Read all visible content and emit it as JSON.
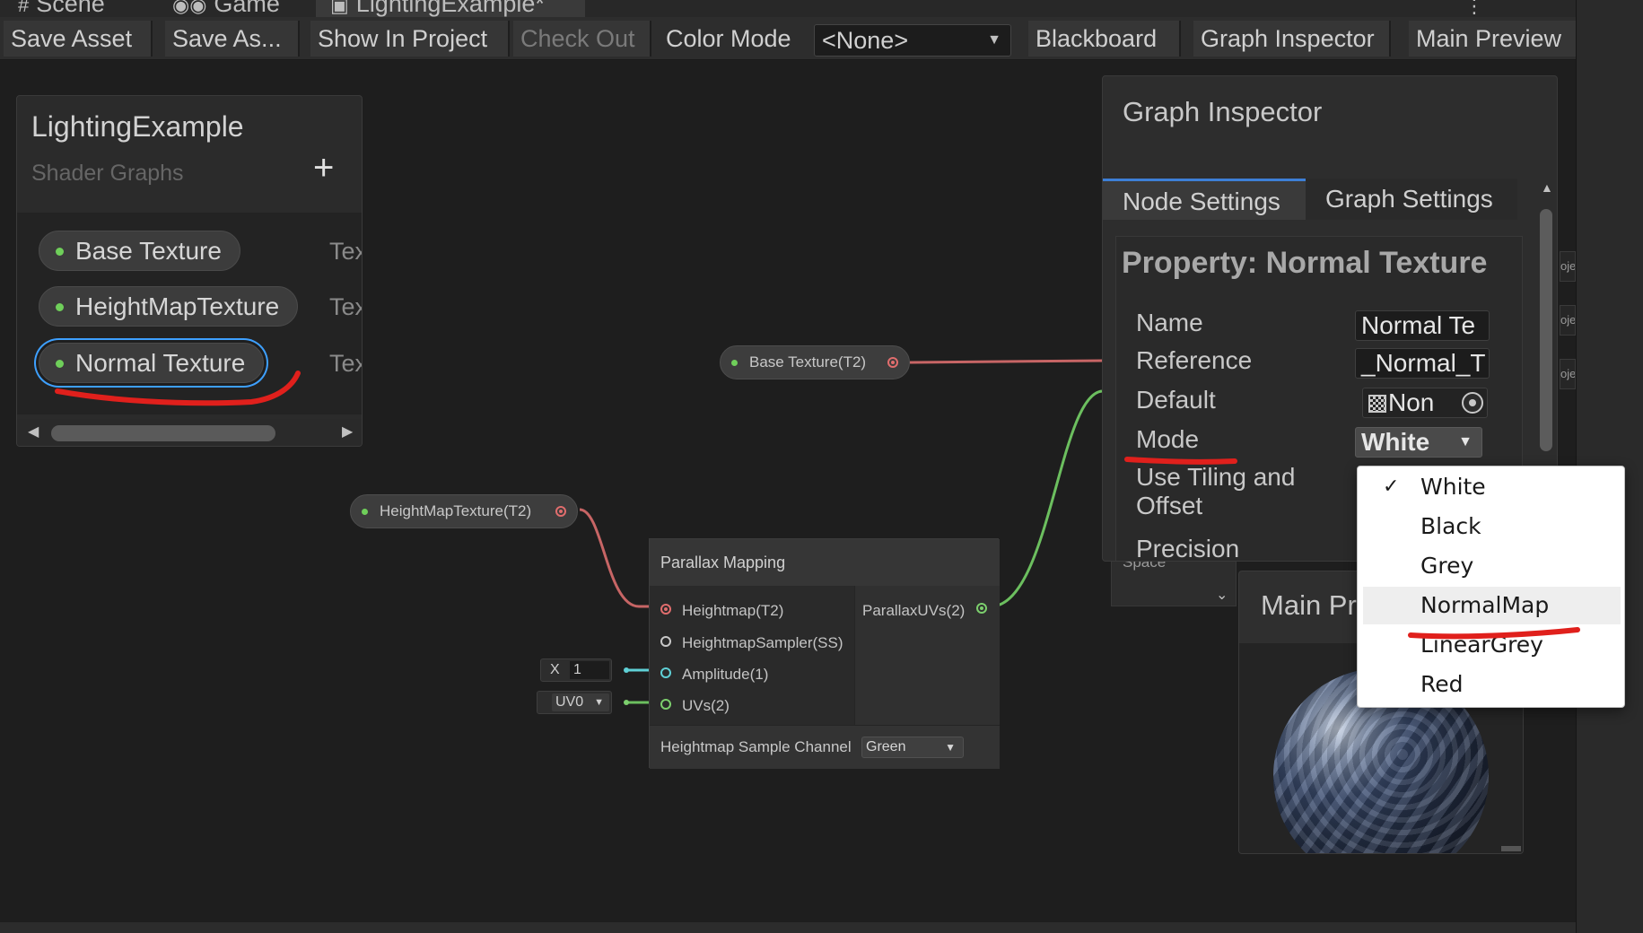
{
  "window_tabs": [
    {
      "label": "Scene",
      "icon": "hash-icon"
    },
    {
      "label": "Game",
      "icon": "gamepad-icon"
    },
    {
      "label": "LightingExample*",
      "icon": "shader-graph-icon"
    }
  ],
  "toolbar": {
    "save_asset": "Save Asset",
    "save_as": "Save As...",
    "show_in_project": "Show In Project",
    "check_out": "Check Out",
    "color_mode_label": "Color Mode",
    "color_mode_value": "<None>",
    "blackboard": "Blackboard",
    "graph_inspector": "Graph Inspector",
    "main_preview": "Main Preview"
  },
  "blackboard": {
    "title": "LightingExample",
    "subtitle": "Shader Graphs",
    "add_symbol": "+",
    "properties": [
      {
        "name": "Base Texture",
        "type": "Tex"
      },
      {
        "name": "HeightMapTexture",
        "type": "Tex"
      },
      {
        "name": "Normal Texture",
        "type": "Tex"
      }
    ]
  },
  "graph_nodes": {
    "base_texture_node": "Base Texture(T2)",
    "heightmap_node": "HeightMapTexture(T2)",
    "parallax": {
      "title": "Parallax Mapping",
      "inputs": [
        "Heightmap(T2)",
        "HeightmapSampler(SS)",
        "Amplitude(1)",
        "UVs(2)"
      ],
      "output": "ParallaxUVs(2)",
      "channel_label": "Heightmap Sample Channel",
      "channel_value": "Green"
    },
    "amplitude_input": {
      "axis": "X",
      "value": "1"
    },
    "uv_input": "UV0"
  },
  "inspector": {
    "title": "Graph Inspector",
    "tabs": [
      "Node Settings",
      "Graph Settings"
    ],
    "property_title": "Property: Normal Texture",
    "fields": {
      "name_label": "Name",
      "name_value": "Normal Te",
      "reference_label": "Reference",
      "reference_value": "_Normal_T",
      "default_label": "Default",
      "default_value": "Non",
      "mode_label": "Mode",
      "mode_value": "White",
      "tiling_label": "Use Tiling and Offset",
      "precision_label": "Precision"
    },
    "partial_text": "Space"
  },
  "mode_dropdown": {
    "options": [
      "White",
      "Black",
      "Grey",
      "NormalMap",
      "LinearGrey",
      "Red"
    ],
    "selected": "White",
    "hovered": "NormalMap",
    "check_mark": "✓"
  },
  "main_preview": {
    "title": "Main Pr"
  },
  "side_fragments": [
    "oje",
    "oje",
    "oje"
  ],
  "colors": {
    "annotation": "#e0201c",
    "selection": "#3ea0ff",
    "texture_port": "#e06d6d",
    "vector_port": "#7ccf6d",
    "float_port": "#5fd0d6"
  }
}
